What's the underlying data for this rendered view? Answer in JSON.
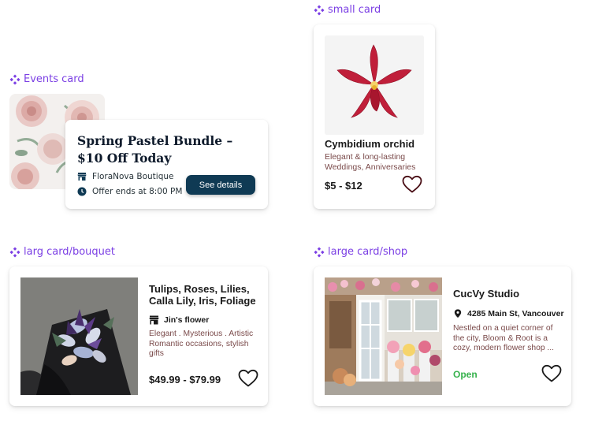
{
  "sections": {
    "events": "Events card",
    "small": "small card",
    "bouquet": "larg card/bouquet",
    "shop": "large card/shop"
  },
  "events_card": {
    "title": "Spring Pastel Bundle – $10 Off Today",
    "shop": "FloraNova Boutique",
    "offer": "Offer ends at 8:00 PM",
    "button": "See details"
  },
  "small_card": {
    "name": "Cymbidium orchid",
    "description": "Elegant & long-lasting Weddings, Anniversaries",
    "price": "$5 - $12"
  },
  "bouquet_card": {
    "title": "Tulips, Roses, Lilies, Calla Lily, Iris, Foliage",
    "shop": "Jin's flower",
    "description": "Elegant . Mysterious . Artistic Romantic occasions, stylish gifts",
    "price": "$49.99 - $79.99"
  },
  "shop_card": {
    "name": "CucVy Studio",
    "address": "4285 Main St, Vancouver",
    "description": "Nestled on a quiet corner of the city, Bloom & Root is a cozy, modern flower shop ...",
    "status": "Open"
  },
  "colors": {
    "accent_purple": "#7b3fe4",
    "button_navy": "#0f3a54",
    "open_green": "#37b24d",
    "desc_brown": "#7a4a4a"
  }
}
